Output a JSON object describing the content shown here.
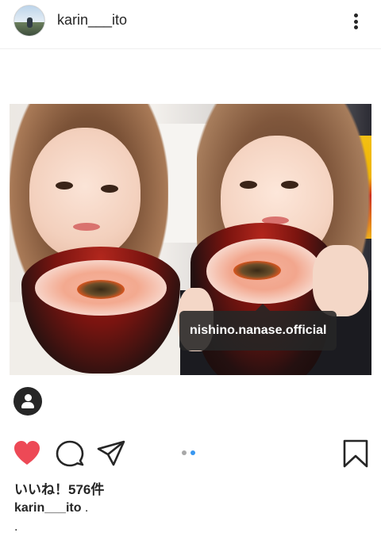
{
  "post": {
    "username": "karin___ito",
    "image_tag": "nishino.nanase.official",
    "likes_text": "いいね！576件",
    "caption_user": "karin___ito",
    "caption_text": " .",
    "caption_line2": "."
  },
  "icons": {
    "more": "more-vertical-icon",
    "tagged": "tagged-user-icon",
    "like": "heart-icon",
    "comment": "comment-icon",
    "share": "share-icon",
    "save": "bookmark-icon"
  },
  "carousel": {
    "total": 2,
    "active_index": 1,
    "active_color": "#3897f0",
    "inactive_color": "#a8a8a8"
  },
  "colors": {
    "like_red": "#ed4956",
    "text": "#262626"
  }
}
